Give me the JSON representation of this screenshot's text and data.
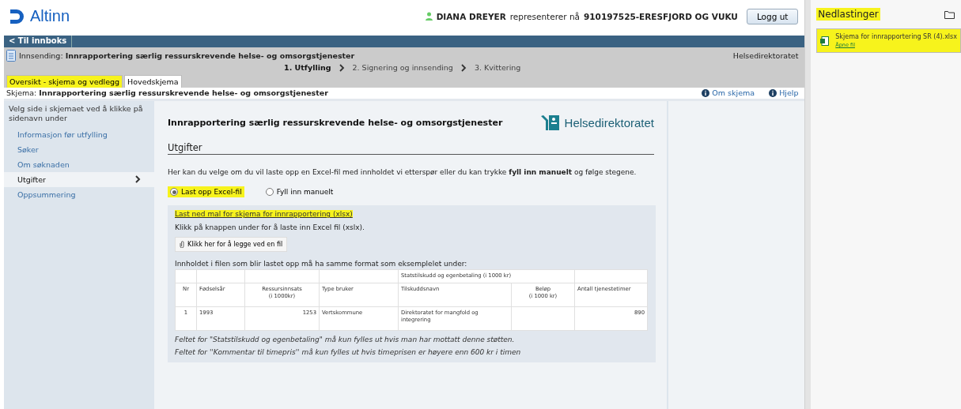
{
  "header": {
    "logo": "Altinn",
    "user": "DIANA DREYER",
    "represents_label": "representerer nå",
    "organization": "910197525-ERESFJORD OG VUKU",
    "logout": "Logg ut"
  },
  "nav": {
    "back": "< Til innboks"
  },
  "submission": {
    "label": "Innsending:",
    "title": "Innrapportering særlig ressurskrevende helse- og omsorgstjenester",
    "agency": "Helsedirektoratet"
  },
  "steps": [
    {
      "label": "1. Utfylling",
      "selected": true
    },
    {
      "label": "2. Signering og innsending",
      "selected": false
    },
    {
      "label": "3. Kvittering",
      "selected": false
    }
  ],
  "tabs": [
    {
      "label": "Oversikt - skjema og vedlegg",
      "selected": false,
      "highlighted": true
    },
    {
      "label": "Hovedskjema",
      "selected": true,
      "highlighted": false
    }
  ],
  "form_bar": {
    "label": "Skjema:",
    "title": "Innrapportering særlig ressurskrevende helse- og omsorgstjenester",
    "links": [
      "Om skjema",
      "Hjelp"
    ]
  },
  "sidebar": {
    "intro": "Velg side i skjemaet ved å klikke på sidenavn under",
    "items": [
      {
        "label": "Informasjon før utfylling",
        "selected": false
      },
      {
        "label": "Søker",
        "selected": false
      },
      {
        "label": "Om søknaden",
        "selected": false
      },
      {
        "label": "Utgifter",
        "selected": true
      },
      {
        "label": "Oppsummering",
        "selected": false
      }
    ]
  },
  "content": {
    "title": "Innrapportering særlig ressurskrevende helse- og omsorgstjenester",
    "agency_logo": "Helsedirektoratet",
    "section": "Utgifter",
    "intro": "Her kan du velge om du vil laste opp en Excel-fil med innholdet vi etterspør eller du kan trykke **fyll inn manuelt** og følge stegene.",
    "options": [
      {
        "label": "Last opp Excel-fil",
        "selected": true,
        "highlighted": true
      },
      {
        "label": "Fyll inn manuelt",
        "selected": false,
        "highlighted": false
      }
    ],
    "upload": {
      "template_link": "Last ned mal for skjema for innrapportering (xlsx)",
      "template_link_highlighted": true,
      "instruction": "Klikk på knappen under for å laste inn Excel fil (xslx).",
      "attach_button": "Klikk her for å legge ved en fil",
      "format_note": "Innholdet i filen som blir lastet opp må ha samme format som eksemplelet under:",
      "table": {
        "group_header": "Statstilskudd og egenbetaling (i 1000 kr)",
        "columns": [
          {
            "label": "Nr"
          },
          {
            "label": "Fødselsår"
          },
          {
            "label": "Ressursinnsats",
            "sub": "(i 1000kr)"
          },
          {
            "label": "Type bruker"
          },
          {
            "label": "Tilskuddsnavn"
          },
          {
            "label": "Beløp",
            "sub": "(i 1000 kr)"
          },
          {
            "label": "Antall tjenestetimer"
          }
        ],
        "rows": [
          [
            "1",
            "1993",
            "1253",
            "Vertskommune",
            "Direktoratet for mangfold og integrering",
            "",
            "890"
          ]
        ]
      },
      "notes": [
        "Feltet for \"Statstilskudd og egenbetaling\" må kun fylles ut hvis man har mottatt denne støtten.",
        "Feltet for ''Kommentar til timepris'' må kun fylles ut hvis timeprisen er høyere enn 600 kr i timen"
      ]
    }
  },
  "downloads": {
    "title": "Nedlastinger",
    "title_highlighted": true,
    "items": [
      {
        "name": "Skjema for innrapportering SR (4).xlsx",
        "action": "Åpne fil",
        "highlighted": true
      }
    ]
  }
}
